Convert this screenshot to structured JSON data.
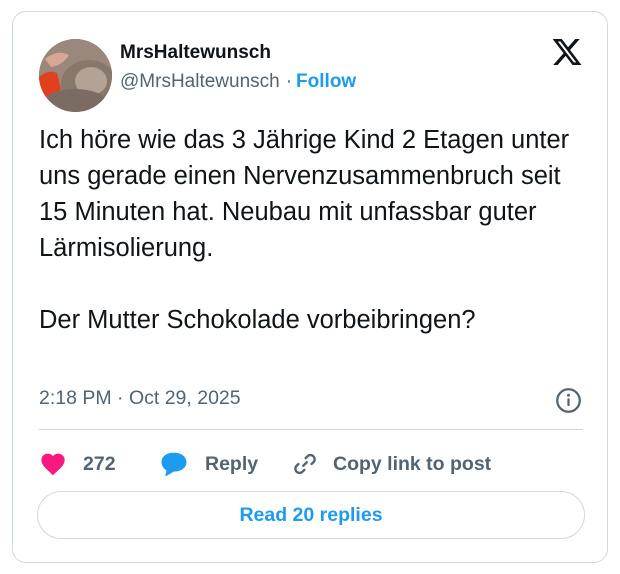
{
  "author": {
    "display_name": "MrsHaltewunsch",
    "handle": "@MrsHaltewunsch",
    "separator": "·",
    "follow_label": "Follow"
  },
  "tweet": {
    "paragraphs": [
      "Ich höre wie das 3 Jährige Kind 2 Etagen unter uns gerade einen Nervenzusammenbruch seit 15 Minuten hat. Neubau mit unfassbar guter Lärmisolierung.",
      "Der Mutter Schokolade vorbeibringen?"
    ],
    "timestamp": "2:18 PM · Oct 29, 2025"
  },
  "actions": {
    "like_count": "272",
    "reply_label": "Reply",
    "copy_link_label": "Copy link to post"
  },
  "read_replies_label": "Read 20 replies",
  "icons": {
    "brand": "x-logo-icon",
    "info": "info-icon",
    "like": "heart-icon",
    "reply": "speech-bubble-icon",
    "copy": "link-icon"
  },
  "colors": {
    "accent": "#1d9bf0",
    "like": "#f91880",
    "text": "#0f1419",
    "muted": "#536471",
    "border": "#cfd9de"
  }
}
